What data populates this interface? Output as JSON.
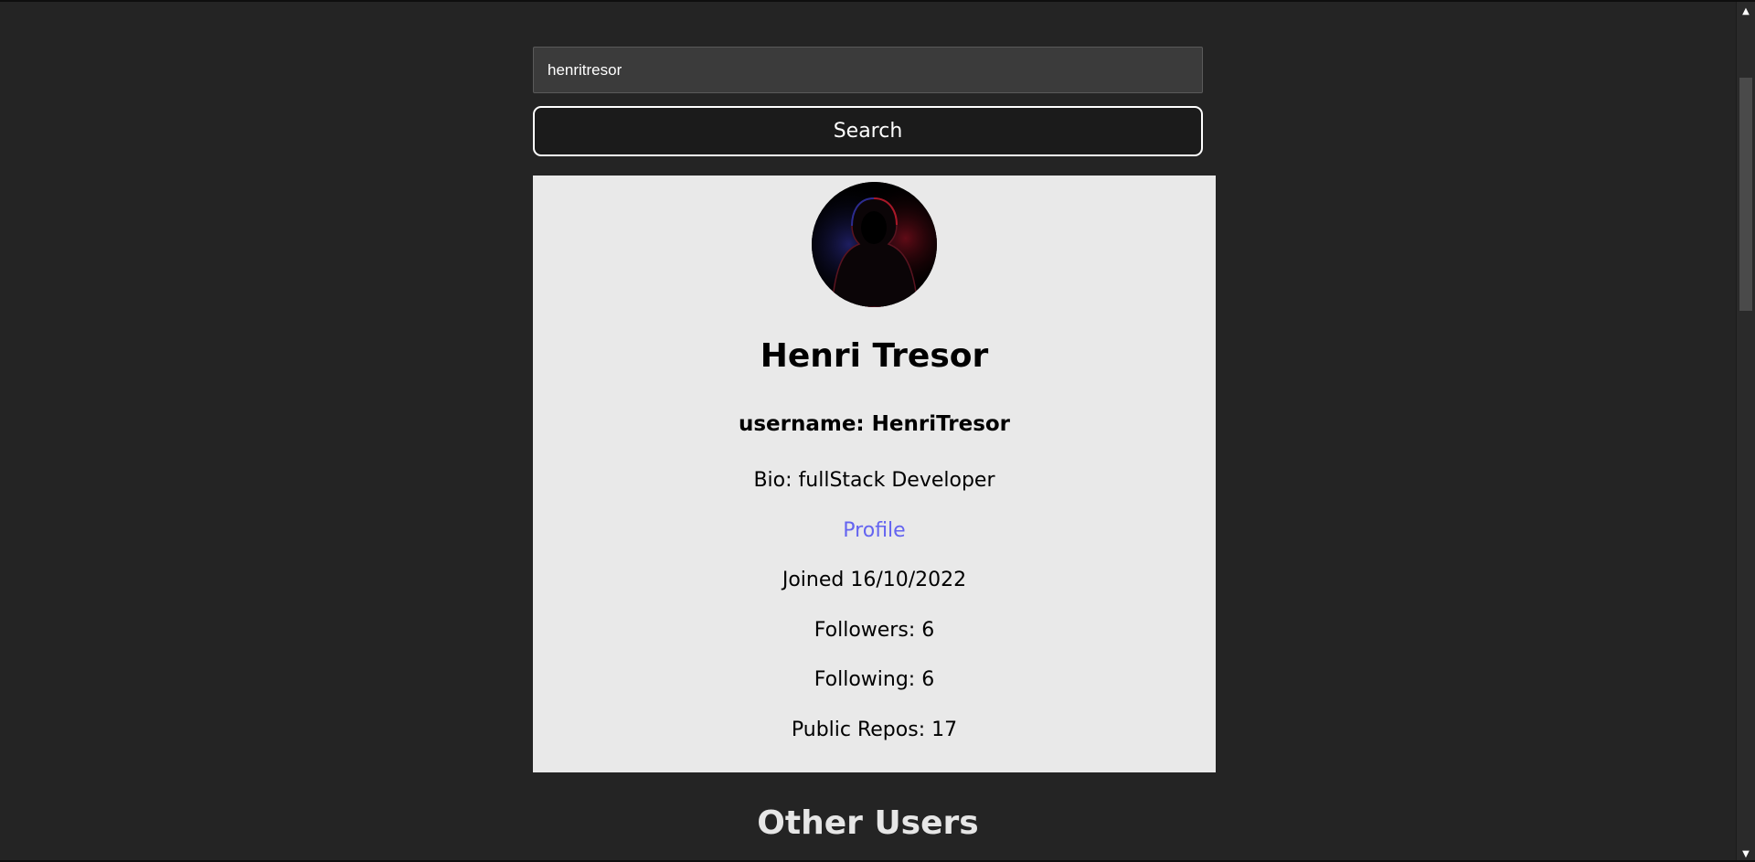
{
  "search": {
    "value": "henritresor",
    "button_label": "Search"
  },
  "user": {
    "name": "Henri Tresor",
    "username": "username: HenriTresor",
    "bio": "Bio: fullStack Developer",
    "profile_link": "Profile",
    "joined": "Joined 16/10/2022",
    "followers": "Followers: 6",
    "following": "Following: 6",
    "public_repos": "Public Repos: 17"
  },
  "other_users": {
    "title": "Other Users"
  },
  "colors": {
    "background": "#242424",
    "card": "#e9e9e9",
    "link": "#6464f0"
  },
  "scrollbar": {
    "up_icon": "scroll-up-arrow-icon",
    "down_icon": "scroll-down-arrow-icon"
  }
}
